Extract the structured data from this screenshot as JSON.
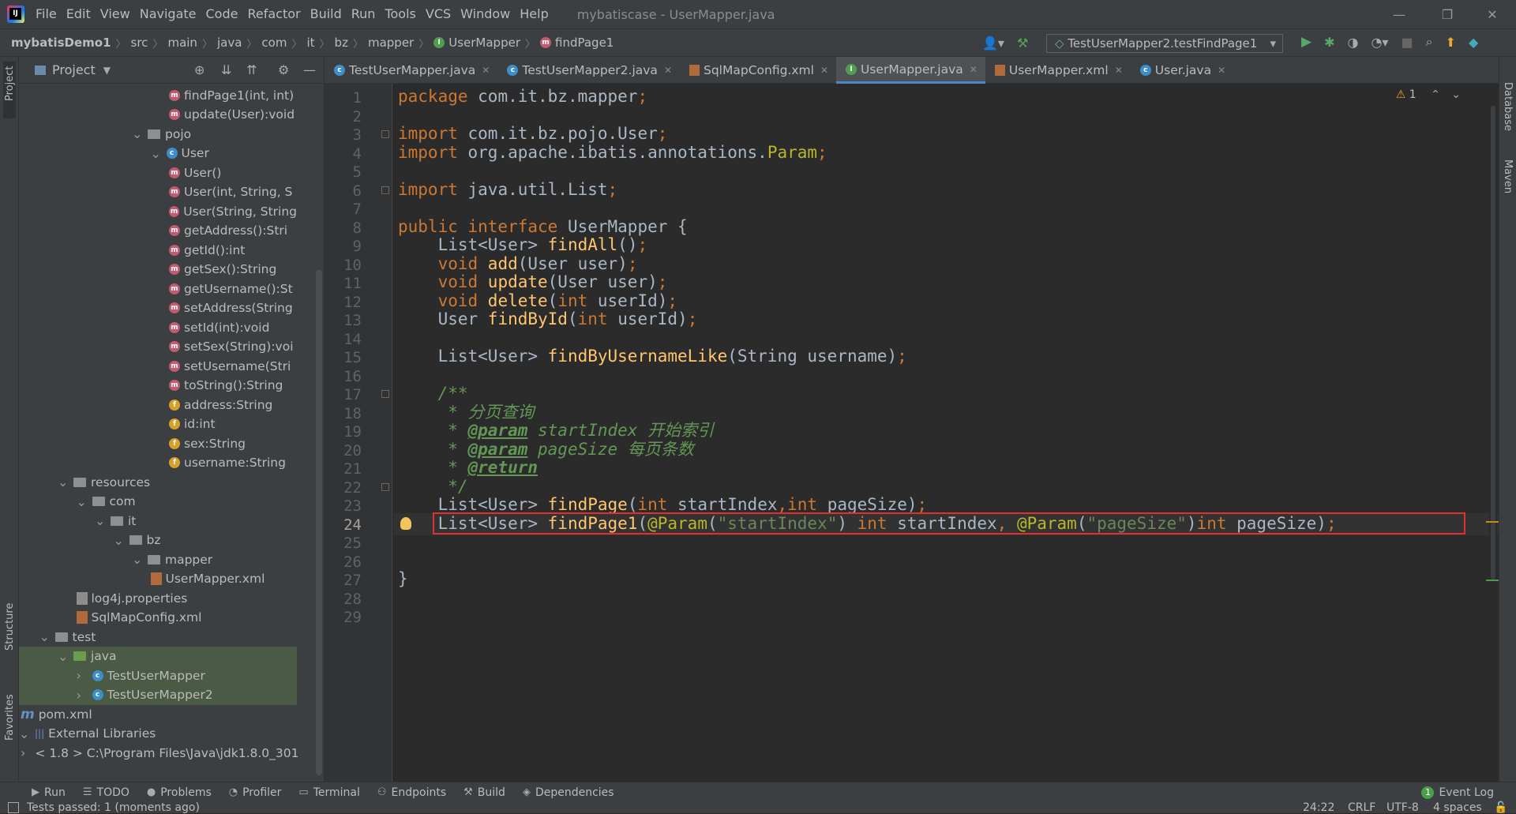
{
  "app": {
    "menu": [
      "File",
      "Edit",
      "View",
      "Navigate",
      "Code",
      "Refactor",
      "Build",
      "Run",
      "Tools",
      "VCS",
      "Window",
      "Help"
    ],
    "window_title": "mybatiscase - UserMapper.java"
  },
  "breadcrumb": [
    "mybatisDemo1",
    "src",
    "main",
    "java",
    "com",
    "it",
    "bz",
    "mapper",
    "UserMapper",
    "findPage1"
  ],
  "run_config": "TestUserMapper2.testFindPage1",
  "side_tools": {
    "project": "Project",
    "structure": "Structure",
    "favorites": "Favorites",
    "database": "Database",
    "maven": "Maven"
  },
  "project_panel": {
    "title": "Project",
    "tree": [
      {
        "indent": 0,
        "icon": "method",
        "label": "findPage1(int, int)"
      },
      {
        "indent": 0,
        "icon": "method",
        "label": "update(User):void"
      },
      {
        "indent": -2,
        "icon": "package",
        "arrow": "down",
        "label": "pojo"
      },
      {
        "indent": -1,
        "icon": "class",
        "arrow": "down",
        "label": "User"
      },
      {
        "indent": 0,
        "icon": "method",
        "label": "User()"
      },
      {
        "indent": 0,
        "icon": "method",
        "label": "User(int, String, S"
      },
      {
        "indent": 0,
        "icon": "method",
        "label": "User(String, String"
      },
      {
        "indent": 0,
        "icon": "method",
        "label": "getAddress():Stri"
      },
      {
        "indent": 0,
        "icon": "method",
        "label": "getId():int"
      },
      {
        "indent": 0,
        "icon": "method",
        "label": "getSex():String"
      },
      {
        "indent": 0,
        "icon": "method",
        "label": "getUsername():St"
      },
      {
        "indent": 0,
        "icon": "method",
        "label": "setAddress(String"
      },
      {
        "indent": 0,
        "icon": "method",
        "label": "setId(int):void"
      },
      {
        "indent": 0,
        "icon": "method",
        "label": "setSex(String):voi"
      },
      {
        "indent": 0,
        "icon": "method",
        "label": "setUsername(Stri"
      },
      {
        "indent": 0,
        "icon": "method",
        "label": "toString():String"
      },
      {
        "indent": 0,
        "icon": "field",
        "label": "address:String"
      },
      {
        "indent": 0,
        "icon": "field",
        "label": "id:int"
      },
      {
        "indent": 0,
        "icon": "field",
        "label": "sex:String"
      },
      {
        "indent": 0,
        "icon": "field",
        "label": "username:String"
      },
      {
        "indent": -6,
        "icon": "resfolder",
        "arrow": "down",
        "label": "resources"
      },
      {
        "indent": -5,
        "icon": "folder",
        "arrow": "down",
        "label": "com"
      },
      {
        "indent": -4,
        "icon": "folder",
        "arrow": "down",
        "label": "it"
      },
      {
        "indent": -3,
        "icon": "folder",
        "arrow": "down",
        "label": "bz"
      },
      {
        "indent": -2,
        "icon": "folder",
        "arrow": "down",
        "label": "mapper"
      },
      {
        "indent": -1,
        "icon": "xml",
        "label": "UserMapper.xml"
      },
      {
        "indent": -5,
        "icon": "props",
        "label": "log4j.properties"
      },
      {
        "indent": -5,
        "icon": "xml",
        "label": "SqlMapConfig.xml"
      },
      {
        "indent": -7,
        "icon": "folder",
        "arrow": "down",
        "label": "test"
      },
      {
        "indent": -6,
        "icon": "greenfolder",
        "arrow": "down",
        "label": "java",
        "hl": true
      },
      {
        "indent": -5,
        "icon": "class",
        "arrow": "right",
        "label": "TestUserMapper",
        "hl": true
      },
      {
        "indent": -5,
        "icon": "class",
        "arrow": "right",
        "label": "TestUserMapper2",
        "hl": true
      },
      {
        "indent": -8,
        "icon": "maven",
        "label": "pom.xml"
      },
      {
        "indent": -9,
        "icon": "lib",
        "arrow": "down",
        "label": "External Libraries"
      },
      {
        "indent": -8,
        "icon": "folder",
        "arrow": "right",
        "label": "< 1.8 >  C:\\Program Files\\Java\\jdk1.8.0_301"
      }
    ]
  },
  "tabs": [
    {
      "label": "TestUserMapper.java",
      "icon": "class"
    },
    {
      "label": "TestUserMapper2.java",
      "icon": "class"
    },
    {
      "label": "SqlMapConfig.xml",
      "icon": "xml"
    },
    {
      "label": "UserMapper.java",
      "icon": "interface",
      "active": true
    },
    {
      "label": "UserMapper.xml",
      "icon": "xml"
    },
    {
      "label": "User.java",
      "icon": "class"
    }
  ],
  "editor": {
    "warning_count": "1",
    "current_line": 24,
    "lines": [
      [
        [
          "kw",
          "package "
        ],
        [
          "p",
          "com.it.bz.mapper"
        ],
        [
          "kw",
          ";"
        ]
      ],
      [],
      [
        [
          "kw",
          "import "
        ],
        [
          "p",
          "com.it.bz.pojo.User"
        ],
        [
          "kw",
          ";"
        ]
      ],
      [
        [
          "kw",
          "import "
        ],
        [
          "p",
          "org.apache.ibatis.annotations."
        ],
        [
          "ann",
          "Param"
        ],
        [
          "kw",
          ";"
        ]
      ],
      [],
      [
        [
          "kw",
          "import "
        ],
        [
          "p",
          "java.util.List"
        ],
        [
          "kw",
          ";"
        ]
      ],
      [],
      [
        [
          "kw",
          "public interface "
        ],
        [
          "p",
          "UserMapper {"
        ]
      ],
      [
        [
          "p",
          "    List<User> "
        ],
        [
          "fn",
          "findAll"
        ],
        [
          "p",
          "()"
        ],
        [
          "kw",
          ";"
        ]
      ],
      [
        [
          "p",
          "    "
        ],
        [
          "kw",
          "void "
        ],
        [
          "fn",
          "add"
        ],
        [
          "p",
          "(User user)"
        ],
        [
          "kw",
          ";"
        ]
      ],
      [
        [
          "p",
          "    "
        ],
        [
          "kw",
          "void "
        ],
        [
          "fn",
          "update"
        ],
        [
          "p",
          "(User user)"
        ],
        [
          "kw",
          ";"
        ]
      ],
      [
        [
          "p",
          "    "
        ],
        [
          "kw",
          "void "
        ],
        [
          "fn",
          "delete"
        ],
        [
          "p",
          "("
        ],
        [
          "kw",
          "int "
        ],
        [
          "p",
          "userId)"
        ],
        [
          "kw",
          ";"
        ]
      ],
      [
        [
          "p",
          "    User "
        ],
        [
          "fn",
          "findById"
        ],
        [
          "p",
          "("
        ],
        [
          "kw",
          "int "
        ],
        [
          "p",
          "userId)"
        ],
        [
          "kw",
          ";"
        ]
      ],
      [],
      [
        [
          "p",
          "    List<User> "
        ],
        [
          "fn",
          "findByUsernameLike"
        ],
        [
          "p",
          "(String username)"
        ],
        [
          "kw",
          ";"
        ]
      ],
      [],
      [
        [
          "cmt",
          "    /**"
        ]
      ],
      [
        [
          "cmt",
          "     * 分页查询"
        ]
      ],
      [
        [
          "cmt",
          "     * "
        ],
        [
          "tag",
          "@param"
        ],
        [
          "cmt",
          " startIndex 开始索引"
        ]
      ],
      [
        [
          "cmt",
          "     * "
        ],
        [
          "tag",
          "@param"
        ],
        [
          "cmt",
          " pageSize 每页条数"
        ]
      ],
      [
        [
          "cmt",
          "     * "
        ],
        [
          "tag",
          "@return"
        ]
      ],
      [
        [
          "cmt",
          "     */"
        ]
      ],
      [
        [
          "p",
          "    List<User> "
        ],
        [
          "fn",
          "findPage"
        ],
        [
          "p",
          "("
        ],
        [
          "kw",
          "int "
        ],
        [
          "p",
          "startIndex"
        ],
        [
          "kw",
          ","
        ],
        [
          "kw",
          "int "
        ],
        [
          "p",
          "pageSize)"
        ],
        [
          "kw",
          ";"
        ]
      ],
      [
        [
          "p",
          "    List<User> "
        ],
        [
          "fn",
          "findPage1"
        ],
        [
          "p",
          "("
        ],
        [
          "ann",
          "@Param"
        ],
        [
          "p",
          "("
        ],
        [
          "str",
          "\"startIndex\""
        ],
        [
          "p",
          ") "
        ],
        [
          "kw",
          "int "
        ],
        [
          "p",
          "startIndex"
        ],
        [
          "kw",
          ", "
        ],
        [
          "ann",
          "@Param"
        ],
        [
          "p",
          "("
        ],
        [
          "str",
          "\"pageSize\""
        ],
        [
          "p",
          ")"
        ],
        [
          "kw",
          "int "
        ],
        [
          "p",
          "pageSize)"
        ],
        [
          "kw",
          ";"
        ]
      ],
      [],
      [],
      [
        [
          "p",
          "}"
        ]
      ],
      [],
      []
    ]
  },
  "bottom_tools": [
    {
      "label": "Run",
      "icon": "▶"
    },
    {
      "label": "TODO",
      "icon": "☰"
    },
    {
      "label": "Problems",
      "icon": "●"
    },
    {
      "label": "Profiler",
      "icon": "◔"
    },
    {
      "label": "Terminal",
      "icon": "▭"
    },
    {
      "label": "Endpoints",
      "icon": "⚇"
    },
    {
      "label": "Build",
      "icon": "⚒"
    },
    {
      "label": "Dependencies",
      "icon": "◈"
    }
  ],
  "event_log": {
    "count": "1",
    "label": "Event Log"
  },
  "status": {
    "message": "Tests passed: 1 (moments ago)",
    "position": "24:22",
    "line_sep": "CRLF",
    "encoding": "UTF-8",
    "indent": "4 spaces"
  },
  "colors": {
    "accent": "#4a88c7",
    "highlight_box": "#e03131",
    "keyword": "#cc7832",
    "function": "#ffc66d",
    "string": "#6a8759",
    "annotation": "#bbb529",
    "comment": "#629755"
  }
}
